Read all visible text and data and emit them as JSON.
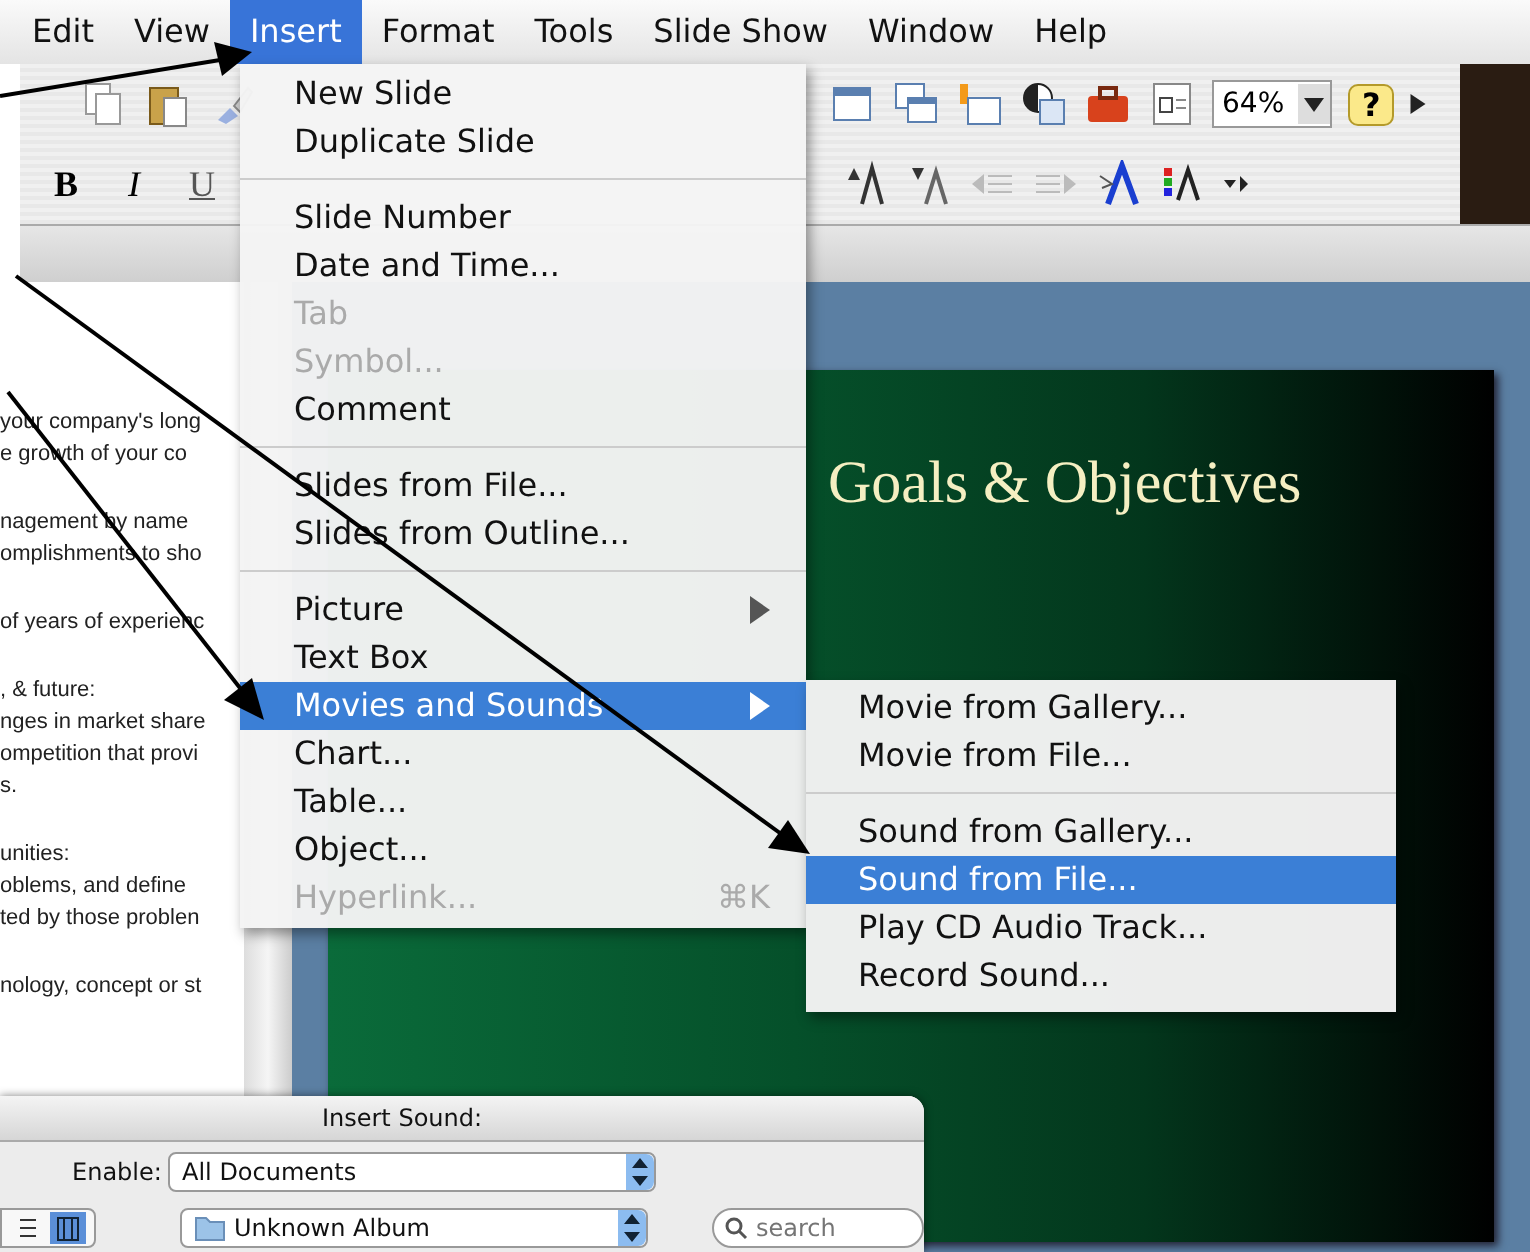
{
  "menu_bar": [
    {
      "label": "Edit",
      "selected": false
    },
    {
      "label": "View",
      "selected": false
    },
    {
      "label": "Insert",
      "selected": true
    },
    {
      "label": "Format",
      "selected": false
    },
    {
      "label": "Tools",
      "selected": false
    },
    {
      "label": "Slide Show",
      "selected": false
    },
    {
      "label": "Window",
      "selected": false
    },
    {
      "label": "Help",
      "selected": false
    }
  ],
  "toolbar": {
    "zoom": "64%",
    "help": "?",
    "format_buttons": [
      "B",
      "I",
      "U"
    ]
  },
  "outline_paragraphs": [
    {
      "lines": [
        "your company's long",
        "e growth of your co"
      ]
    },
    {
      "lines": [
        "nagement by name",
        "omplishments to sho"
      ]
    },
    {
      "lines": [
        "of years of experienc"
      ]
    },
    {
      "lines": [
        ", & future:",
        "nges in market share",
        "ompetition that provi",
        "s."
      ]
    },
    {
      "lines": [
        "unities:",
        "oblems, and define",
        "ted by those problen"
      ]
    },
    {
      "lines": [
        "nology, concept or st"
      ]
    }
  ],
  "slide": {
    "title": "Goals & Objectives"
  },
  "insert_menu": [
    {
      "kind": "item",
      "label": "New Slide",
      "disabled": false,
      "selected": false,
      "submenu": false
    },
    {
      "kind": "item",
      "label": "Duplicate Slide",
      "disabled": false,
      "selected": false,
      "submenu": false
    },
    {
      "kind": "separator"
    },
    {
      "kind": "item",
      "label": "Slide Number",
      "disabled": false,
      "selected": false,
      "submenu": false
    },
    {
      "kind": "item",
      "label": "Date and Time...",
      "disabled": false,
      "selected": false,
      "submenu": false
    },
    {
      "kind": "item",
      "label": "Tab",
      "disabled": true,
      "selected": false,
      "submenu": false
    },
    {
      "kind": "item",
      "label": "Symbol...",
      "disabled": true,
      "selected": false,
      "submenu": false
    },
    {
      "kind": "item",
      "label": "Comment",
      "disabled": false,
      "selected": false,
      "submenu": false
    },
    {
      "kind": "separator"
    },
    {
      "kind": "item",
      "label": "Slides from File...",
      "disabled": false,
      "selected": false,
      "submenu": false
    },
    {
      "kind": "item",
      "label": "Slides from Outline...",
      "disabled": false,
      "selected": false,
      "submenu": false
    },
    {
      "kind": "separator"
    },
    {
      "kind": "item",
      "label": "Picture",
      "disabled": false,
      "selected": false,
      "submenu": true
    },
    {
      "kind": "item",
      "label": "Text Box",
      "disabled": false,
      "selected": false,
      "submenu": false
    },
    {
      "kind": "item",
      "label": "Movies and Sounds",
      "disabled": false,
      "selected": true,
      "submenu": true
    },
    {
      "kind": "item",
      "label": "Chart...",
      "disabled": false,
      "selected": false,
      "submenu": false
    },
    {
      "kind": "item",
      "label": "Table...",
      "disabled": false,
      "selected": false,
      "submenu": false
    },
    {
      "kind": "item",
      "label": "Object...",
      "disabled": false,
      "selected": false,
      "submenu": false
    },
    {
      "kind": "item",
      "label": "Hyperlink...",
      "disabled": true,
      "selected": false,
      "submenu": false,
      "shortcut": "⌘K"
    }
  ],
  "sounds_submenu": [
    {
      "kind": "item",
      "label": "Movie from Gallery...",
      "selected": false
    },
    {
      "kind": "item",
      "label": "Movie from File...",
      "selected": false
    },
    {
      "kind": "separator"
    },
    {
      "kind": "item",
      "label": "Sound from Gallery...",
      "selected": false
    },
    {
      "kind": "item",
      "label": "Sound from File...",
      "selected": true
    },
    {
      "kind": "item",
      "label": "Play CD Audio Track...",
      "selected": false
    },
    {
      "kind": "item",
      "label": "Record Sound...",
      "selected": false
    }
  ],
  "dialog": {
    "title": "Insert Sound:",
    "enable_label": "Enable:",
    "enable_value": "All Documents",
    "location": "Unknown Album",
    "search_placeholder": "search"
  }
}
